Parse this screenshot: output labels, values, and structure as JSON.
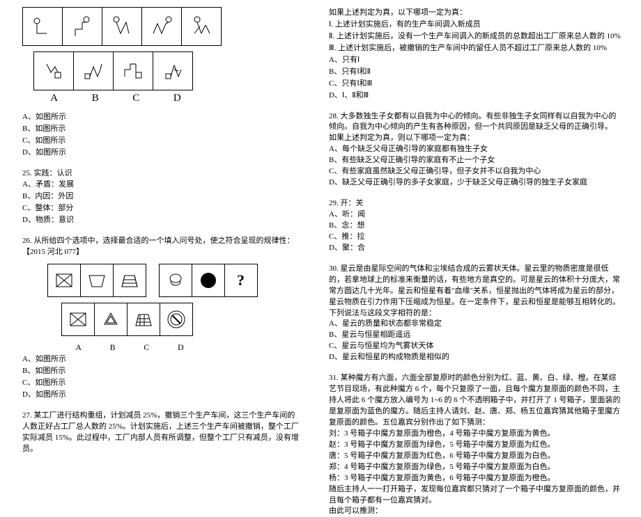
{
  "q24": {
    "row1_labels": [
      "A",
      "B",
      "C",
      "D"
    ],
    "opts": [
      "A、如图所示",
      "B、如图所示",
      "C、如图所示",
      "D、如图所示"
    ]
  },
  "q25": {
    "title": "25. 实践：认识",
    "opts": [
      "A、矛盾：发展",
      "B、内因：外因",
      "C、整体：部分",
      "D、物质：意识"
    ]
  },
  "q26": {
    "title": "26. 从所给四个选项中，选择最合适的一个填入问号处，使之符合呈现的规律性：【2015 河北 077】",
    "row_labels": [
      "A",
      "B",
      "C",
      "D"
    ],
    "opts": [
      "A、如图所示",
      "B、如图所示",
      "C、如图所示",
      "D、如图所示"
    ]
  },
  "q27": {
    "title": "27. 某工厂进行结构重组，计划减员 25%，撤销三个生产车间，这三个生产车间的人数正好占工厂总人数的 25%。计划实施后，上述三个生产车间被撤销，整个工厂实际减员 15%。此过程中，工厂内部人员有所调整，但整个工厂只有减员，没有增员。"
  },
  "q27b": {
    "lead": "如果上述判定为真，以下哪项一定为真：",
    "i": "Ⅰ. 上述计划实施后，有的生产车间调入新成员",
    "ii": "Ⅱ. 上述计划实施后，没有一个生产车间调入的新成员的总数超出工厂原来总人数的 10%",
    "iii": "Ⅲ. 上述计划实施后，被撤销的生产车间中的留任人员不超过工厂原来总人数的 10%",
    "opts": [
      "A、只有Ⅰ",
      "B、只有Ⅰ和Ⅱ",
      "C、只有Ⅰ和Ⅲ",
      "D、Ⅰ、Ⅱ和Ⅲ"
    ]
  },
  "q28": {
    "title": "28. 大多数独生子女都有以自我为中心的倾向。有些非独生子女同样有以自我为中心的倾向。自我为中心倾向的产生有各种原因，但一个共同原因是缺乏父母的正确引导。",
    "lead": "如果上述判定为真，则以下哪项一定为真：",
    "opts": [
      "A、每个缺乏父母正确引导的家庭都有独生子女",
      "B、有些缺乏父母正确引导的家庭有不止一个子女",
      "C、有些家庭虽然缺乏父母正确引导，但子女并不以自我为中心",
      "D、缺乏父母正确引导的多子女家庭，少于缺乏父母正确引导的独生子女家庭"
    ]
  },
  "q29": {
    "title": "29. 开：关",
    "opts": [
      "A、听：闻",
      "B、念：想",
      "C、推：拉",
      "D、聚：合"
    ]
  },
  "q30": {
    "title": "30. 星云是由星际空间的气体和尘埃结合成的云雾状天体。星云里的物质密度是很低的，若拿地球上的标准来衡量的话，有些地方是真空的。可是星云的体积十分庞大，常常方圆达几十光年。星云和恒星有着\"血缘\"关系，恒星抛出的气体将成为星云的部分，星云物质在引力作用下压缩成为恒星。在一定条件下，星云和恒星是能够互相转化的。",
    "lead": "下列说法与这段文字相符的是：",
    "opts": [
      "A、星云的质量和状态都非常稳定",
      "B、星云与恒星相距遥远",
      "C、星云与恒星均为气雾状天体",
      "D、星云和恒星的构成物质是相似的"
    ]
  },
  "q31": {
    "title": "31. 某种魔方有六面，六面全部复原时的颜色分别为红、蓝、黄、白、绿、橙。在某综艺节目现场，有此种魔方 6 个，每个只复原了一面，且每个魔方复原面的颜色不同，主持人将此 6 个魔方放入编号为 1~6 的 6 个不透明箱子中，并打开了 1 号箱子，里面装的是复原面为蓝色的魔方。随后主持人请刘、赵、唐、郑、杨五位嘉宾猜其他箱子里魔方复原面的颜色。五位嘉宾分别作出了如下猜测：",
    "g1": "刘：3 号箱子中魔方复原面为橙色，4 号箱子中魔方复原面为黄色。",
    "g2": "赵：3 号箱子中魔方复原面为绿色，5 号箱子中魔方复原面为红色。",
    "g3": "唐：5 号箱子中魔方复原面为红色，6 号箱子中魔方复原面为白色。",
    "g4": "郑：4 号箱子中魔方复原面为绿色，5 号箱子中魔方复原面为白色。",
    "g5": "杨：3 号箱子中魔方复原面为黄色，6 号箱子中魔方复原面为橙色。",
    "tail": "随后主持人一一打开箱子，发现每位嘉宾都只猜对了一个箱子中魔方复原面的颜色，并且每个箱子都有一位嘉宾猜对。",
    "lead": "由此可以推测："
  }
}
